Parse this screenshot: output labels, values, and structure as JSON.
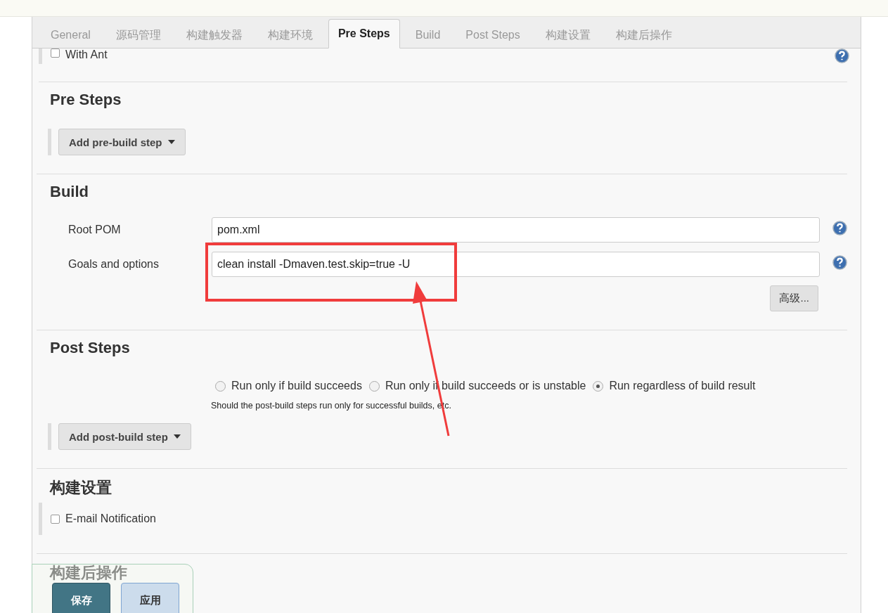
{
  "tabs": [
    {
      "label": "General",
      "selected": false
    },
    {
      "label": "源码管理",
      "selected": false
    },
    {
      "label": "构建触发器",
      "selected": false
    },
    {
      "label": "构建环境",
      "selected": false
    },
    {
      "label": "Pre Steps",
      "selected": true
    },
    {
      "label": "Build",
      "selected": false
    },
    {
      "label": "Post Steps",
      "selected": false
    },
    {
      "label": "构建设置",
      "selected": false
    },
    {
      "label": "构建后操作",
      "selected": false
    }
  ],
  "top_option": {
    "label": "With Ant",
    "checked": false
  },
  "sections": [
    {
      "kind": "steps",
      "title": "Pre Steps",
      "button": "Add pre-build step"
    },
    {
      "kind": "build",
      "title": "Build",
      "fields": [
        {
          "label": "Root POM",
          "value": "pom.xml",
          "highlighted": false
        },
        {
          "label": "Goals and options",
          "value": "clean install -Dmaven.test.skip=true -U",
          "highlighted": true
        }
      ],
      "advanced_button": "高级..."
    },
    {
      "kind": "post",
      "title": "Post Steps",
      "options": [
        {
          "label": "Run only if build succeeds",
          "selected": false
        },
        {
          "label": "Run only if build succeeds or is unstable",
          "selected": false
        },
        {
          "label": "Run regardless of build result",
          "selected": true
        }
      ],
      "hint": "Should the post-build steps run only for successful builds, etc.",
      "button": "Add post-build step"
    },
    {
      "kind": "checkbox",
      "title": "构建设置",
      "options": [
        {
          "label": "E-mail Notification",
          "checked": false
        }
      ]
    },
    {
      "kind": "heading",
      "title": "构建后操作"
    }
  ],
  "bottom_bar": {
    "buttons": [
      {
        "label": "保存",
        "kind": "primary"
      },
      {
        "label": "应用",
        "kind": "secondary"
      }
    ]
  }
}
